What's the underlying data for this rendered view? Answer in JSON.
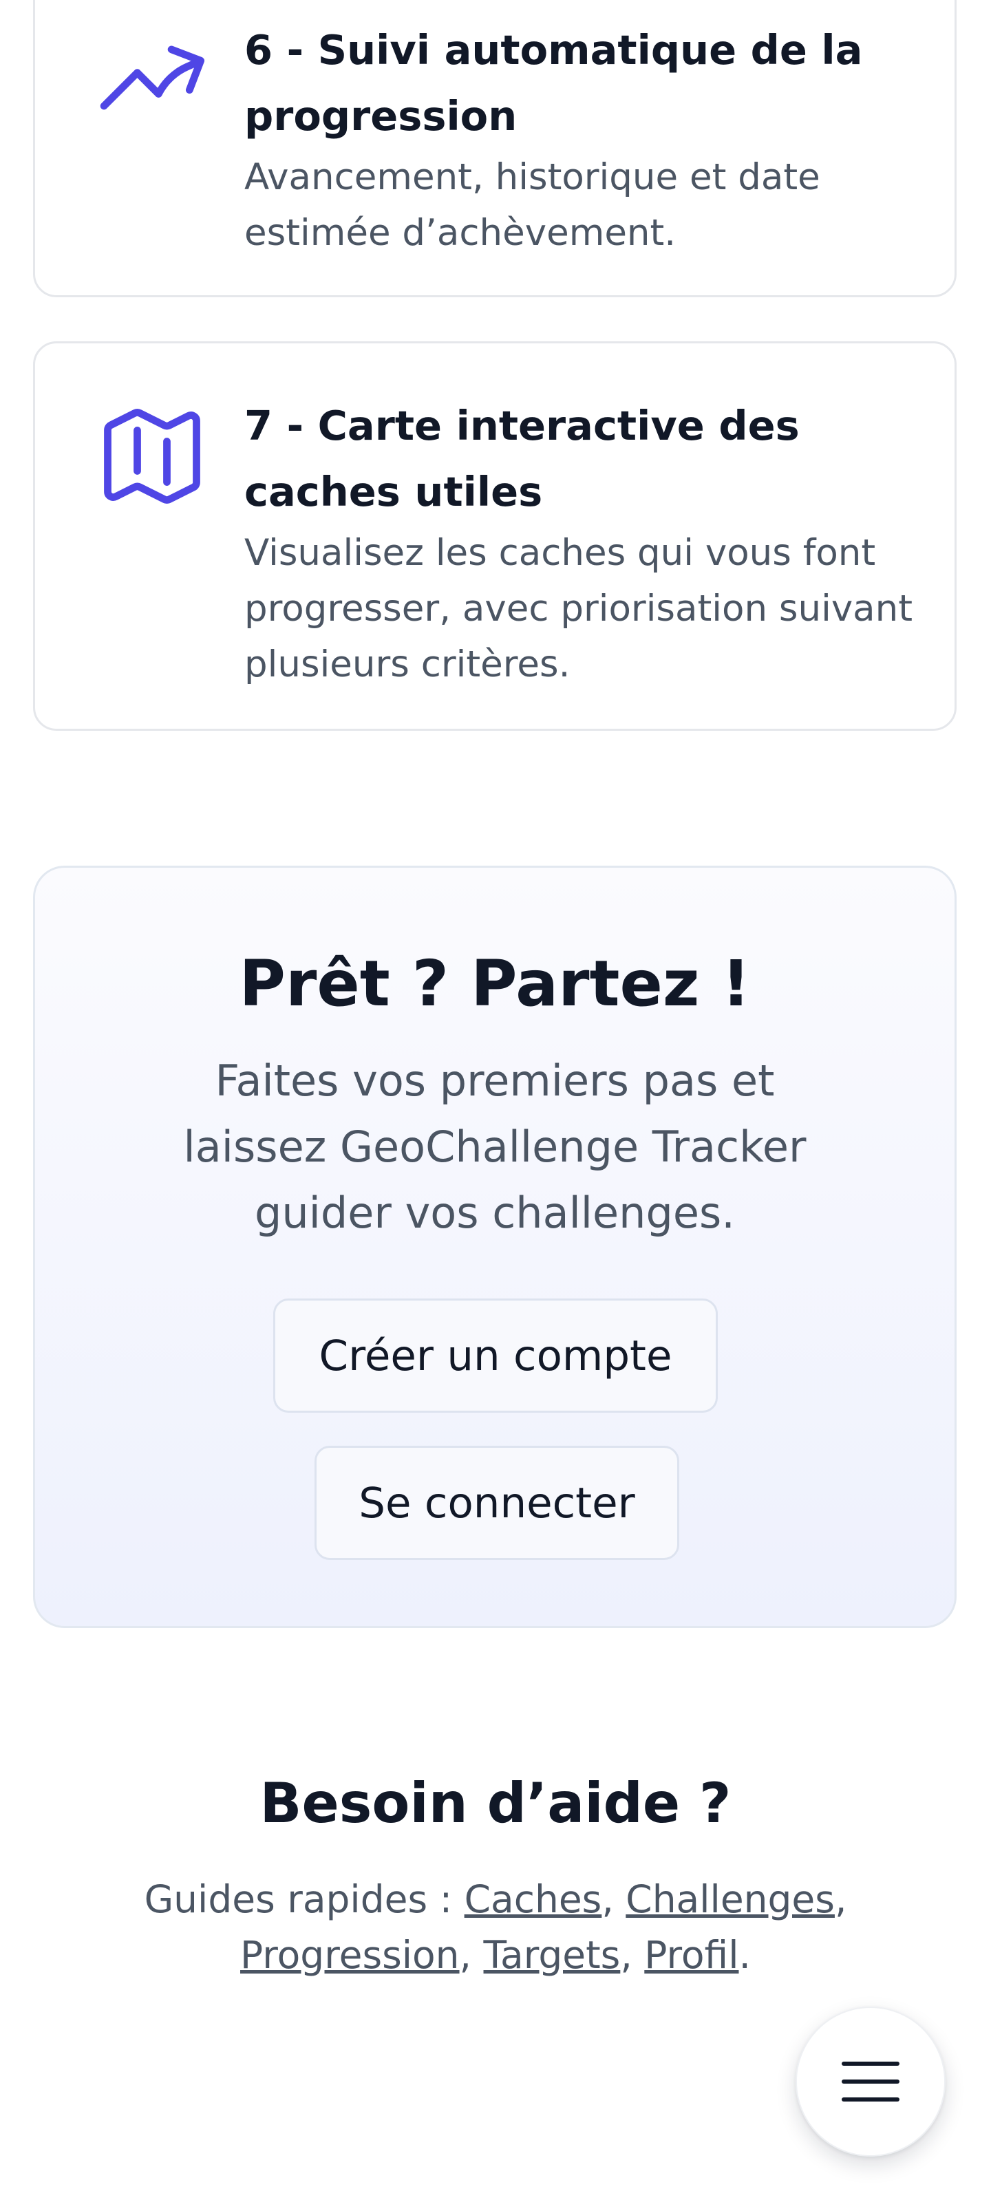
{
  "features": [
    {
      "title": "6 - Suivi automatique de la progression",
      "description": "Avancement, historique et date estimée d’achèvement.",
      "icon": "trending-up-icon"
    },
    {
      "title": "7 - Carte interactive des caches utiles",
      "description": "Visualisez les caches qui vous font progresser, avec priorisation suivant plusieurs critères.",
      "icon": "map-icon"
    }
  ],
  "cta": {
    "title": "Prêt ? Partez !",
    "subtitle": "Faites vos premiers pas et laissez GeoChallenge Tracker guider vos challenges.",
    "signup_label": "Créer un compte",
    "login_label": "Se connecter"
  },
  "help": {
    "title": "Besoin d’aide ?",
    "prefix": "Guides rapides : ",
    "links": [
      "Caches",
      "Challenges",
      "Progression",
      "Targets",
      "Profil"
    ],
    "separator": ", ",
    "end": "."
  },
  "menu": {
    "icon": "hamburger-menu-icon"
  },
  "colors": {
    "accent": "#4f46e5",
    "text_dark": "#111827",
    "text_muted": "#4b5563",
    "border": "#e5e7eb"
  }
}
